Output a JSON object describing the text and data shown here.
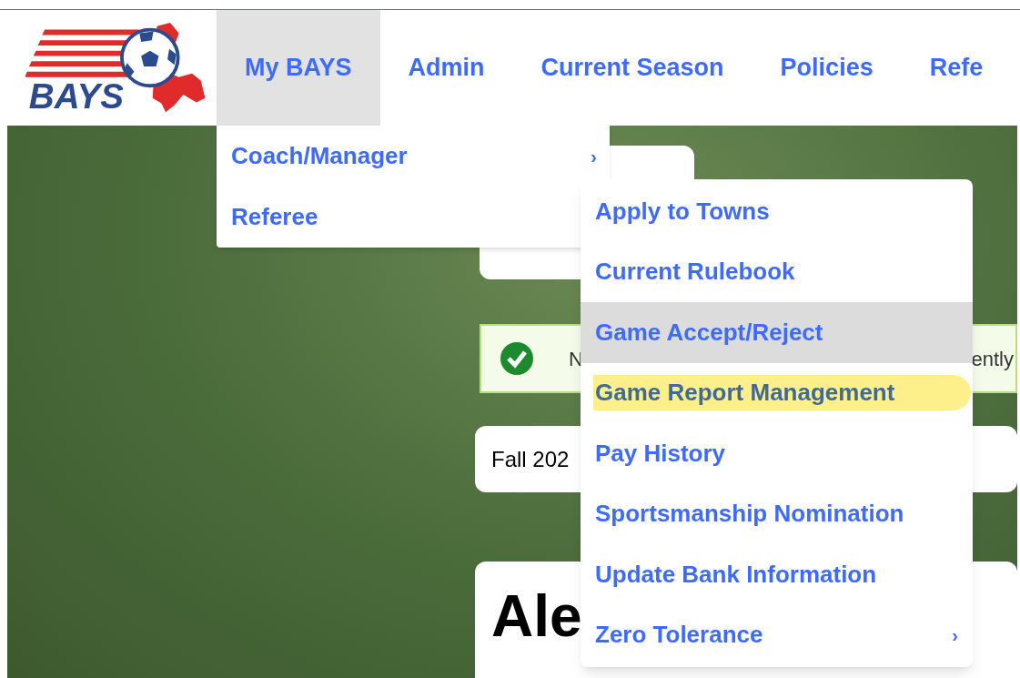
{
  "logo": {
    "text": "BAYS"
  },
  "nav": {
    "items": [
      {
        "label": "My BAYS",
        "selected": true
      },
      {
        "label": "Admin",
        "selected": false
      },
      {
        "label": "Current Season",
        "selected": false
      },
      {
        "label": "Policies",
        "selected": false
      },
      {
        "label": "Refe",
        "selected": false
      }
    ]
  },
  "dropdown": {
    "items": [
      {
        "label": "Coach/Manager",
        "chevron": "›"
      },
      {
        "label": "Referee"
      }
    ]
  },
  "submenu": {
    "items": [
      {
        "label": "Apply to Towns",
        "selected": false,
        "highlighted": false
      },
      {
        "label": "Current Rulebook",
        "selected": false,
        "highlighted": false
      },
      {
        "label": "Game Accept/Reject",
        "selected": true,
        "highlighted": false
      },
      {
        "label": "Game Report Management",
        "selected": false,
        "highlighted": true
      },
      {
        "label": "Pay History",
        "selected": false,
        "highlighted": false
      },
      {
        "label": "Sportsmanship Nomination",
        "selected": false,
        "highlighted": false
      },
      {
        "label": "Update Bank Information",
        "selected": false,
        "highlighted": false
      },
      {
        "label": "Zero Tolerance",
        "selected": false,
        "highlighted": false,
        "chevron": "›"
      }
    ]
  },
  "alert": {
    "text_start": "N",
    "text_end": "ently"
  },
  "season_card": {
    "text": "Fall 202"
  },
  "profile_card": {
    "heading": "Ale"
  }
}
